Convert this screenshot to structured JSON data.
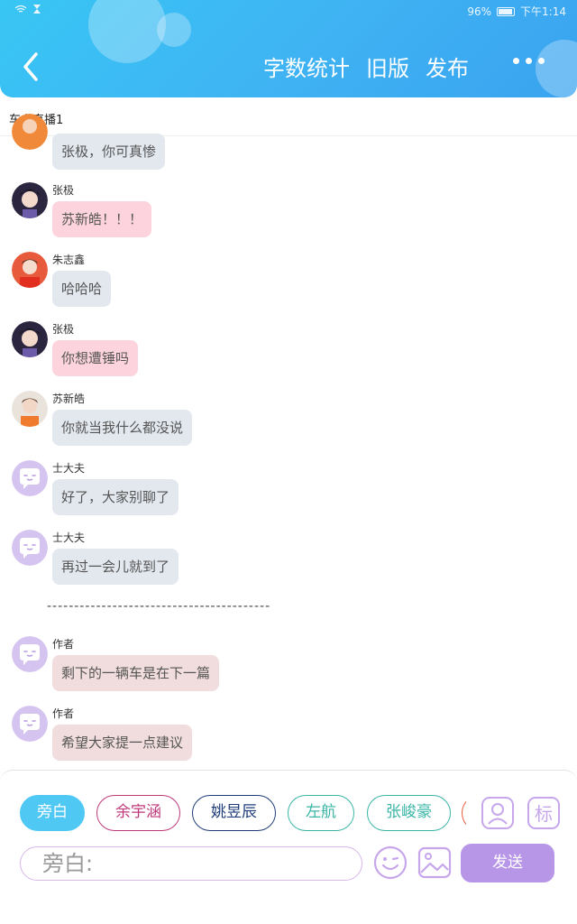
{
  "status_bar": {
    "battery": "96%",
    "time": "下午1:14"
  },
  "header": {
    "word_count": "字数统计",
    "old_version": "旧版",
    "publish": "发布"
  },
  "chapter_title": "车上直播1",
  "messages": [
    {
      "sender": "",
      "text": "张极，你可真惨",
      "avatar": "orange-avatar"
    },
    {
      "sender": "张极",
      "text": "苏新皓！！！",
      "avatar": "zhangji-avatar"
    },
    {
      "sender": "朱志鑫",
      "text": "哈哈哈",
      "avatar": "zhuzhixin-avatar"
    },
    {
      "sender": "张极",
      "text": "你想遭锤吗",
      "avatar": "zhangji-avatar"
    },
    {
      "sender": "苏新皓",
      "text": "你就当我什么都没说",
      "avatar": "suxinhao-avatar"
    },
    {
      "sender": "士大夫",
      "text": "好了，大家别聊了",
      "avatar": "chat-bubble-avatar"
    },
    {
      "sender": "士大夫",
      "text": "再过一会儿就到了",
      "avatar": "chat-bubble-avatar"
    },
    {
      "sender": "作者",
      "text": "剩下的一辆车是在下一篇",
      "avatar": "chat-bubble-avatar"
    },
    {
      "sender": "作者",
      "text": "希望大家提一点建议",
      "avatar": "chat-bubble-avatar"
    }
  ],
  "separator": "-----------------------------------------",
  "characters": [
    {
      "name": "旁白",
      "color": "#4fc8f4"
    },
    {
      "name": "余宇涵",
      "color": "#c0397a"
    },
    {
      "name": "姚昱辰",
      "color": "#1f3d7a"
    },
    {
      "name": "左航",
      "color": "#38b5a5"
    },
    {
      "name": "张峻豪",
      "color": "#38b5a5"
    }
  ],
  "tools": {
    "profile_icon": "person-card-icon",
    "tag_icon": "biao-tag-icon",
    "tag_label": "标"
  },
  "input": {
    "placeholder": "旁白:"
  },
  "send_label": "发送",
  "colors": {
    "header": "#3fb4f3",
    "send": "#b796e8",
    "accent": "#4fc8f4"
  }
}
